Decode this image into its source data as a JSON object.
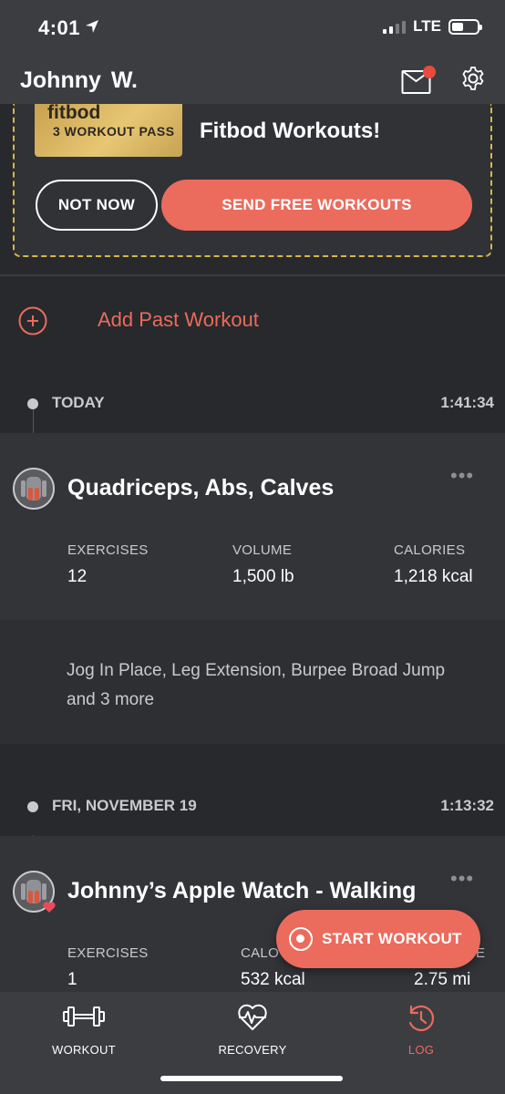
{
  "status_bar": {
    "time": "4:01",
    "network": "LTE",
    "icons": [
      "location-arrow-icon",
      "signal-icon",
      "battery-icon"
    ]
  },
  "header": {
    "title": "Johnny  W.",
    "icons": [
      "mail-icon",
      "gear-icon"
    ],
    "notification_dot_color": "#e94b3c"
  },
  "promo": {
    "brand": "fitbod",
    "pass_label": "3 WORKOUT PASS",
    "title": "Fitbod Workouts!",
    "not_now_label": "NOT NOW",
    "send_label": "SEND FREE WORKOUTS"
  },
  "add_past": {
    "label": "Add Past Workout"
  },
  "days": [
    {
      "label": "TODAY",
      "duration": "1:41:34",
      "workout": {
        "title": "Quadriceps, Abs, Calves",
        "menu": "•••",
        "stats": [
          {
            "label": "EXERCISES",
            "value": "12"
          },
          {
            "label": "VOLUME",
            "value": "1,500 lb"
          },
          {
            "label": "CALORIES",
            "value": "1,218 kcal"
          }
        ],
        "exercises": "Jog In Place, Leg Extension, Burpee Broad Jump and 3 more"
      }
    },
    {
      "label": "FRI, NOVEMBER 19",
      "duration": "1:13:32",
      "workout": {
        "title": "Johnny’s Apple Watch - Walking",
        "menu": "•••",
        "stats": [
          {
            "label": "EXERCISES",
            "value": "1"
          },
          {
            "label": "CALO",
            "value": "532 kcal"
          },
          {
            "label": "E",
            "value": "2.75 mi"
          }
        ]
      }
    }
  ],
  "fab": {
    "label": "START WORKOUT"
  },
  "tabs": [
    {
      "label": "WORKOUT",
      "icon": "dumbbell-icon",
      "active": false
    },
    {
      "label": "RECOVERY",
      "icon": "recovery-heart-icon",
      "active": false
    },
    {
      "label": "LOG",
      "icon": "log-clock-icon",
      "active": true
    }
  ],
  "colors": {
    "accent": "#eb6b5d",
    "background": "#27292c",
    "card": "#323438",
    "promo_border": "#d6b84a"
  }
}
